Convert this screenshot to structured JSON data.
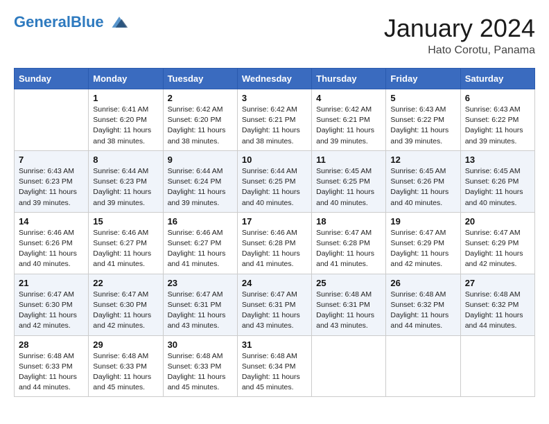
{
  "header": {
    "logo_line1": "General",
    "logo_line2": "Blue",
    "month_year": "January 2024",
    "location": "Hato Corotu, Panama"
  },
  "days_of_week": [
    "Sunday",
    "Monday",
    "Tuesday",
    "Wednesday",
    "Thursday",
    "Friday",
    "Saturday"
  ],
  "weeks": [
    [
      {
        "day": "",
        "info": ""
      },
      {
        "day": "1",
        "info": "Sunrise: 6:41 AM\nSunset: 6:20 PM\nDaylight: 11 hours\nand 38 minutes."
      },
      {
        "day": "2",
        "info": "Sunrise: 6:42 AM\nSunset: 6:20 PM\nDaylight: 11 hours\nand 38 minutes."
      },
      {
        "day": "3",
        "info": "Sunrise: 6:42 AM\nSunset: 6:21 PM\nDaylight: 11 hours\nand 38 minutes."
      },
      {
        "day": "4",
        "info": "Sunrise: 6:42 AM\nSunset: 6:21 PM\nDaylight: 11 hours\nand 39 minutes."
      },
      {
        "day": "5",
        "info": "Sunrise: 6:43 AM\nSunset: 6:22 PM\nDaylight: 11 hours\nand 39 minutes."
      },
      {
        "day": "6",
        "info": "Sunrise: 6:43 AM\nSunset: 6:22 PM\nDaylight: 11 hours\nand 39 minutes."
      }
    ],
    [
      {
        "day": "7",
        "info": "Sunrise: 6:43 AM\nSunset: 6:23 PM\nDaylight: 11 hours\nand 39 minutes."
      },
      {
        "day": "8",
        "info": "Sunrise: 6:44 AM\nSunset: 6:23 PM\nDaylight: 11 hours\nand 39 minutes."
      },
      {
        "day": "9",
        "info": "Sunrise: 6:44 AM\nSunset: 6:24 PM\nDaylight: 11 hours\nand 39 minutes."
      },
      {
        "day": "10",
        "info": "Sunrise: 6:44 AM\nSunset: 6:25 PM\nDaylight: 11 hours\nand 40 minutes."
      },
      {
        "day": "11",
        "info": "Sunrise: 6:45 AM\nSunset: 6:25 PM\nDaylight: 11 hours\nand 40 minutes."
      },
      {
        "day": "12",
        "info": "Sunrise: 6:45 AM\nSunset: 6:26 PM\nDaylight: 11 hours\nand 40 minutes."
      },
      {
        "day": "13",
        "info": "Sunrise: 6:45 AM\nSunset: 6:26 PM\nDaylight: 11 hours\nand 40 minutes."
      }
    ],
    [
      {
        "day": "14",
        "info": "Sunrise: 6:46 AM\nSunset: 6:26 PM\nDaylight: 11 hours\nand 40 minutes."
      },
      {
        "day": "15",
        "info": "Sunrise: 6:46 AM\nSunset: 6:27 PM\nDaylight: 11 hours\nand 41 minutes."
      },
      {
        "day": "16",
        "info": "Sunrise: 6:46 AM\nSunset: 6:27 PM\nDaylight: 11 hours\nand 41 minutes."
      },
      {
        "day": "17",
        "info": "Sunrise: 6:46 AM\nSunset: 6:28 PM\nDaylight: 11 hours\nand 41 minutes."
      },
      {
        "day": "18",
        "info": "Sunrise: 6:47 AM\nSunset: 6:28 PM\nDaylight: 11 hours\nand 41 minutes."
      },
      {
        "day": "19",
        "info": "Sunrise: 6:47 AM\nSunset: 6:29 PM\nDaylight: 11 hours\nand 42 minutes."
      },
      {
        "day": "20",
        "info": "Sunrise: 6:47 AM\nSunset: 6:29 PM\nDaylight: 11 hours\nand 42 minutes."
      }
    ],
    [
      {
        "day": "21",
        "info": "Sunrise: 6:47 AM\nSunset: 6:30 PM\nDaylight: 11 hours\nand 42 minutes."
      },
      {
        "day": "22",
        "info": "Sunrise: 6:47 AM\nSunset: 6:30 PM\nDaylight: 11 hours\nand 42 minutes."
      },
      {
        "day": "23",
        "info": "Sunrise: 6:47 AM\nSunset: 6:31 PM\nDaylight: 11 hours\nand 43 minutes."
      },
      {
        "day": "24",
        "info": "Sunrise: 6:47 AM\nSunset: 6:31 PM\nDaylight: 11 hours\nand 43 minutes."
      },
      {
        "day": "25",
        "info": "Sunrise: 6:48 AM\nSunset: 6:31 PM\nDaylight: 11 hours\nand 43 minutes."
      },
      {
        "day": "26",
        "info": "Sunrise: 6:48 AM\nSunset: 6:32 PM\nDaylight: 11 hours\nand 44 minutes."
      },
      {
        "day": "27",
        "info": "Sunrise: 6:48 AM\nSunset: 6:32 PM\nDaylight: 11 hours\nand 44 minutes."
      }
    ],
    [
      {
        "day": "28",
        "info": "Sunrise: 6:48 AM\nSunset: 6:33 PM\nDaylight: 11 hours\nand 44 minutes."
      },
      {
        "day": "29",
        "info": "Sunrise: 6:48 AM\nSunset: 6:33 PM\nDaylight: 11 hours\nand 45 minutes."
      },
      {
        "day": "30",
        "info": "Sunrise: 6:48 AM\nSunset: 6:33 PM\nDaylight: 11 hours\nand 45 minutes."
      },
      {
        "day": "31",
        "info": "Sunrise: 6:48 AM\nSunset: 6:34 PM\nDaylight: 11 hours\nand 45 minutes."
      },
      {
        "day": "",
        "info": ""
      },
      {
        "day": "",
        "info": ""
      },
      {
        "day": "",
        "info": ""
      }
    ]
  ]
}
